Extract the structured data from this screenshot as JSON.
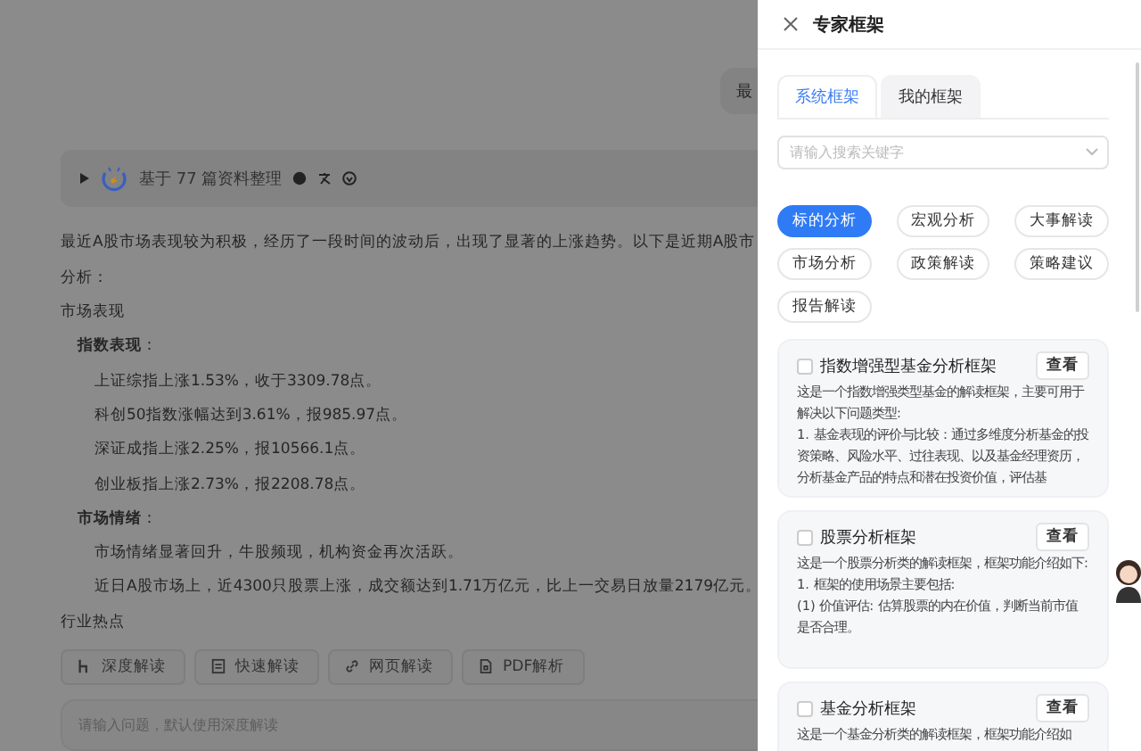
{
  "chat": {
    "user_bubble": "最",
    "sources": {
      "label": "基于 77 篇资料整理",
      "expanded": false
    },
    "intro": [
      "最近A股市场表现较为积极，经历了一段时间的波动后，出现了显著的上涨趋势。以下是近期A股市",
      "分析："
    ],
    "sections": [
      {
        "heading": "市场表现",
        "groups": [
          {
            "label": "**指数表现**：",
            "lines": [
              "上证综指上涨1.53%，收于3309.78点。",
              "科创50指数涨幅达到3.61%，报985.97点。",
              "深证成指上涨2.25%，报10566.1点。",
              "创业板指上涨2.73%，报2208.78点。"
            ]
          },
          {
            "label": "**市场情绪**：",
            "lines": [
              "市场情绪显著回升，牛股频现，机构资金再次活跃。",
              "近日A股市场上，近4300只股票上涨，成交额达到1.71万亿元，比上一交易日放量2179亿元。"
            ]
          }
        ]
      },
      {
        "heading": "行业热点"
      }
    ],
    "modes": [
      {
        "kind": "deep",
        "label": "深度解读"
      },
      {
        "kind": "quick",
        "label": "快速解读"
      },
      {
        "kind": "web",
        "label": "网页解读"
      },
      {
        "kind": "pdf",
        "label": "PDF解析"
      }
    ],
    "input": {
      "placeholder": "请输入问题，默认使用深度解读"
    }
  },
  "drawer": {
    "title": "专家框架",
    "tabs": [
      {
        "label": "系统框架",
        "selected": true
      },
      {
        "label": "我的框架",
        "selected": false
      }
    ],
    "search": {
      "placeholder": "请输入搜索关键字"
    },
    "categories": [
      {
        "label": "标的分析",
        "selected": true
      },
      {
        "label": "宏观分析",
        "selected": false
      },
      {
        "label": "大事解读",
        "selected": false
      },
      {
        "label": "市场分析",
        "selected": false
      },
      {
        "label": "政策解读",
        "selected": false
      },
      {
        "label": "策略建议",
        "selected": false
      },
      {
        "label": "报告解读",
        "selected": false
      }
    ],
    "frameworks": [
      {
        "title": "指数增强型基金分析框架",
        "checked": false,
        "action": "查看",
        "lines": [
          "这是一个指数增强类型基金的解读框架，主要可用于解决以下问题类型:",
          "1. 基金表现的评价与比较：通过多维度分析基金的投资策略、风险水平、过往表现、以及基金经理资历，分析基金产品的特点和潜在投资价值，评估基"
        ]
      },
      {
        "title": "股票分析框架",
        "checked": false,
        "action": "查看",
        "lines": [
          "这是一个股票分析类的解读框架，框架功能介绍如下:",
          "1. 框架的使用场景主要包括:",
          "(1) 价值评估: 估算股票的内在价值，判断当前市值是否合理。"
        ]
      },
      {
        "title": "基金分析框架",
        "checked": false,
        "action": "查看",
        "lines": [
          "这是一个基金分析类的解读框架，框架功能介绍如"
        ]
      }
    ]
  }
}
